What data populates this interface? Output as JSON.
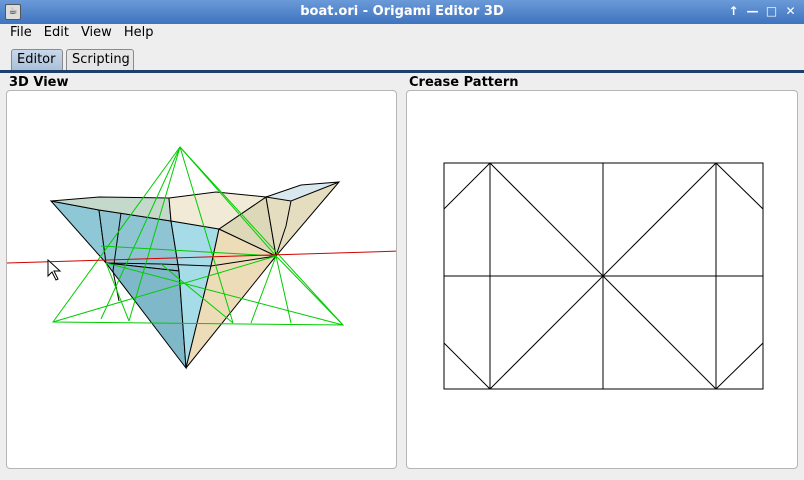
{
  "window": {
    "title": "boat.ori - Origami Editor 3D",
    "controls": [
      "↑",
      "—",
      "□",
      "✕"
    ]
  },
  "menu": [
    "File",
    "Edit",
    "View",
    "Help"
  ],
  "tabs": [
    {
      "label": "Editor",
      "active": true
    },
    {
      "label": "Scripting",
      "active": false
    }
  ],
  "panels": {
    "left_title": "3D View",
    "right_title": "Crease Pattern"
  },
  "colors": {
    "titlebar": "#4a7fc8",
    "tab_underline": "#1d3f6e",
    "fold_line": "#d00000",
    "wireframe": "#00cc00",
    "face_blue": "#8ec7d6",
    "face_cream": "#efe3c5"
  }
}
